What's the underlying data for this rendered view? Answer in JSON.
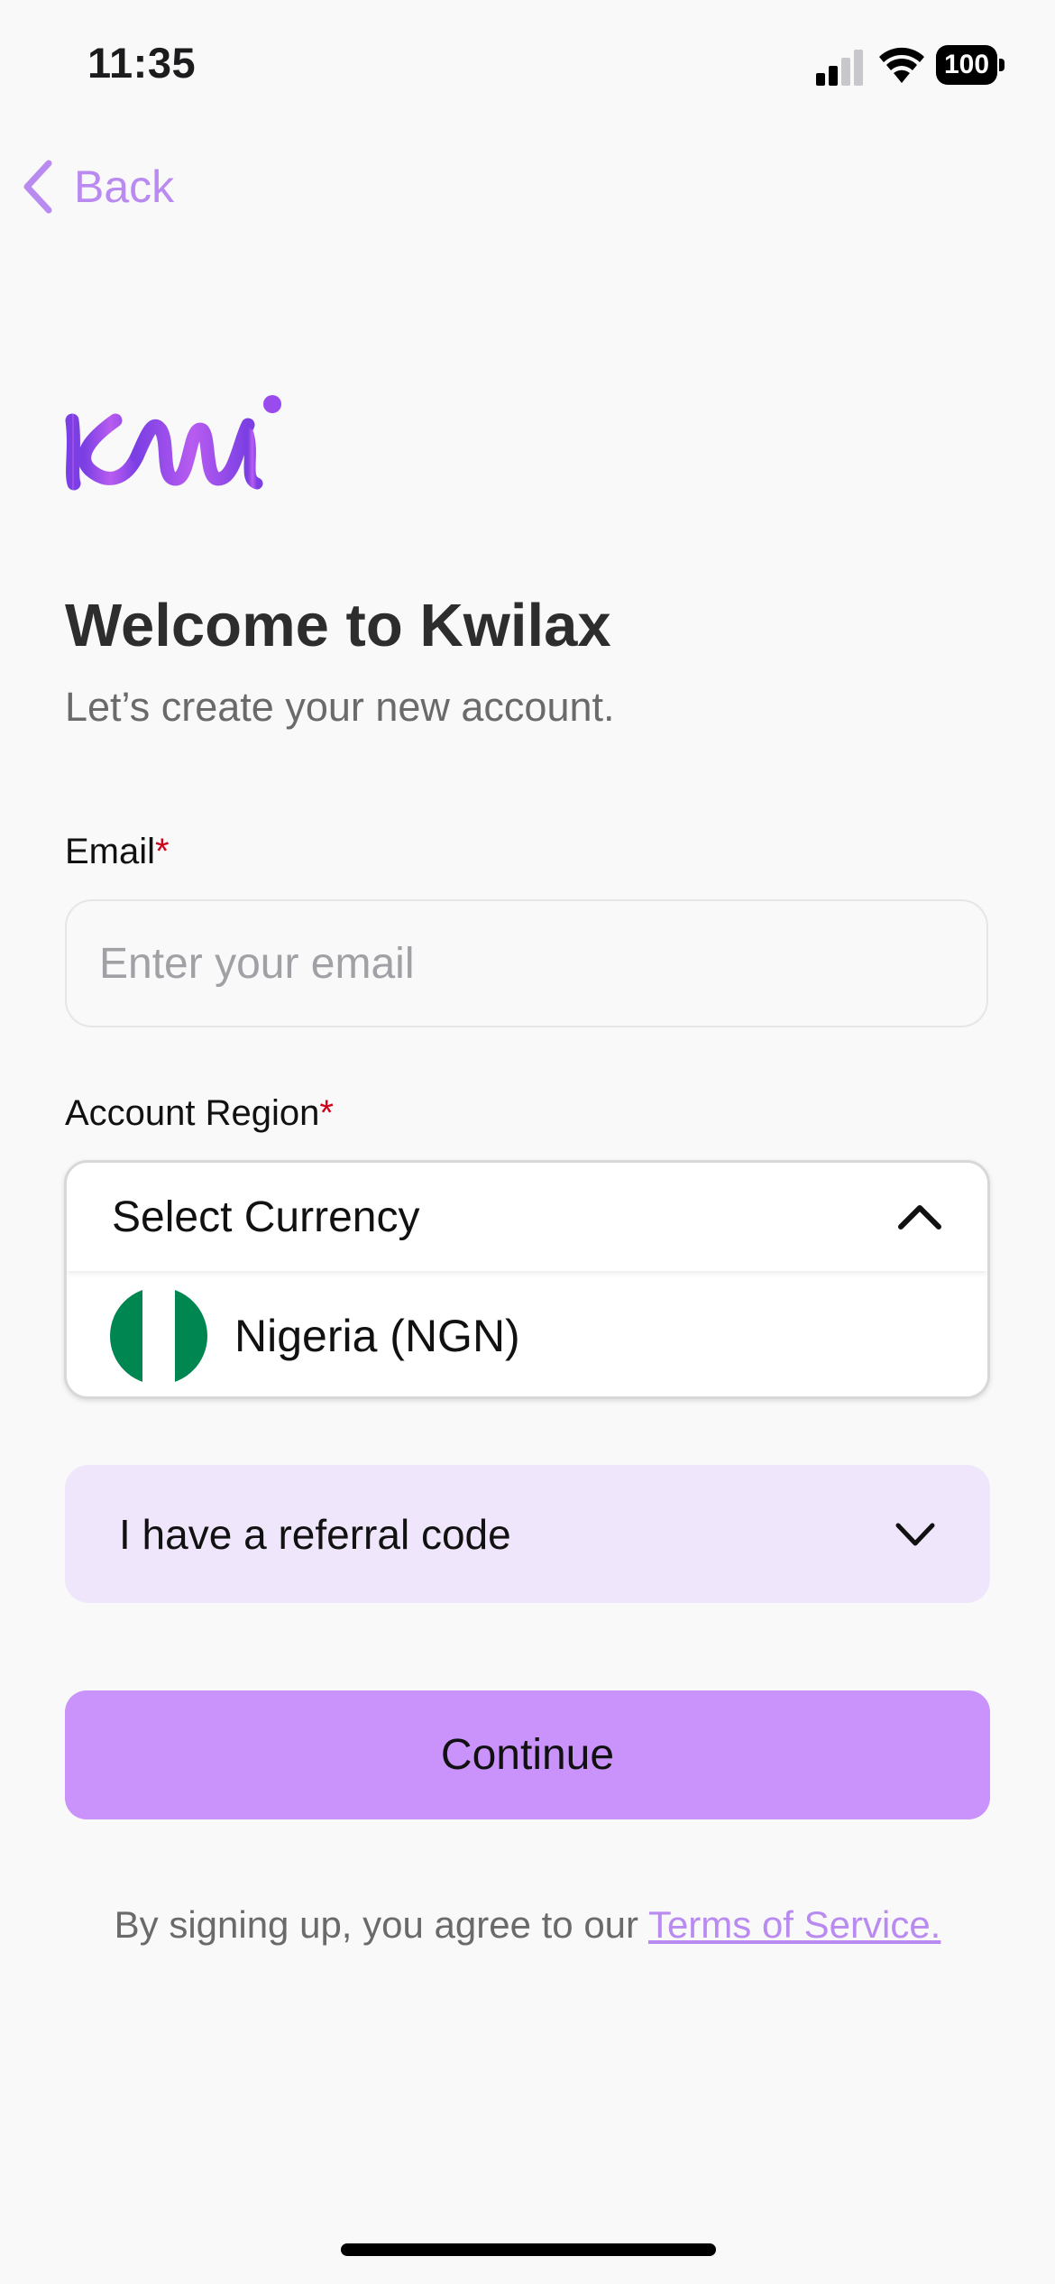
{
  "status_bar": {
    "time": "11:35",
    "battery": "100",
    "icons": [
      "signal-icon",
      "wifi-icon",
      "battery-icon"
    ]
  },
  "nav": {
    "back_label": "Back",
    "back_icon": "chevron-left-icon"
  },
  "brand": {
    "logo": "kwilax-logo",
    "accent_color": "#b98af0",
    "button_color": "#c993fb"
  },
  "header": {
    "title": "Welcome to Kwilax",
    "subtitle": "Let’s create your new account."
  },
  "form": {
    "email": {
      "label": "Email",
      "required_mark": "*",
      "placeholder": "Enter your email",
      "value": ""
    },
    "region": {
      "label": "Account Region",
      "required_mark": "*",
      "dropdown": {
        "placeholder": "Select Currency",
        "expanded": true,
        "icon": "chevron-up-icon",
        "options": [
          {
            "label": "Nigeria (NGN)",
            "flag": "nigeria-flag-icon"
          }
        ]
      }
    },
    "referral": {
      "label": "I have a referral code",
      "icon": "chevron-down-icon"
    },
    "continue_label": "Continue"
  },
  "footer": {
    "terms_text": "By signing up, you agree to our ",
    "terms_link": "Terms of Service."
  }
}
